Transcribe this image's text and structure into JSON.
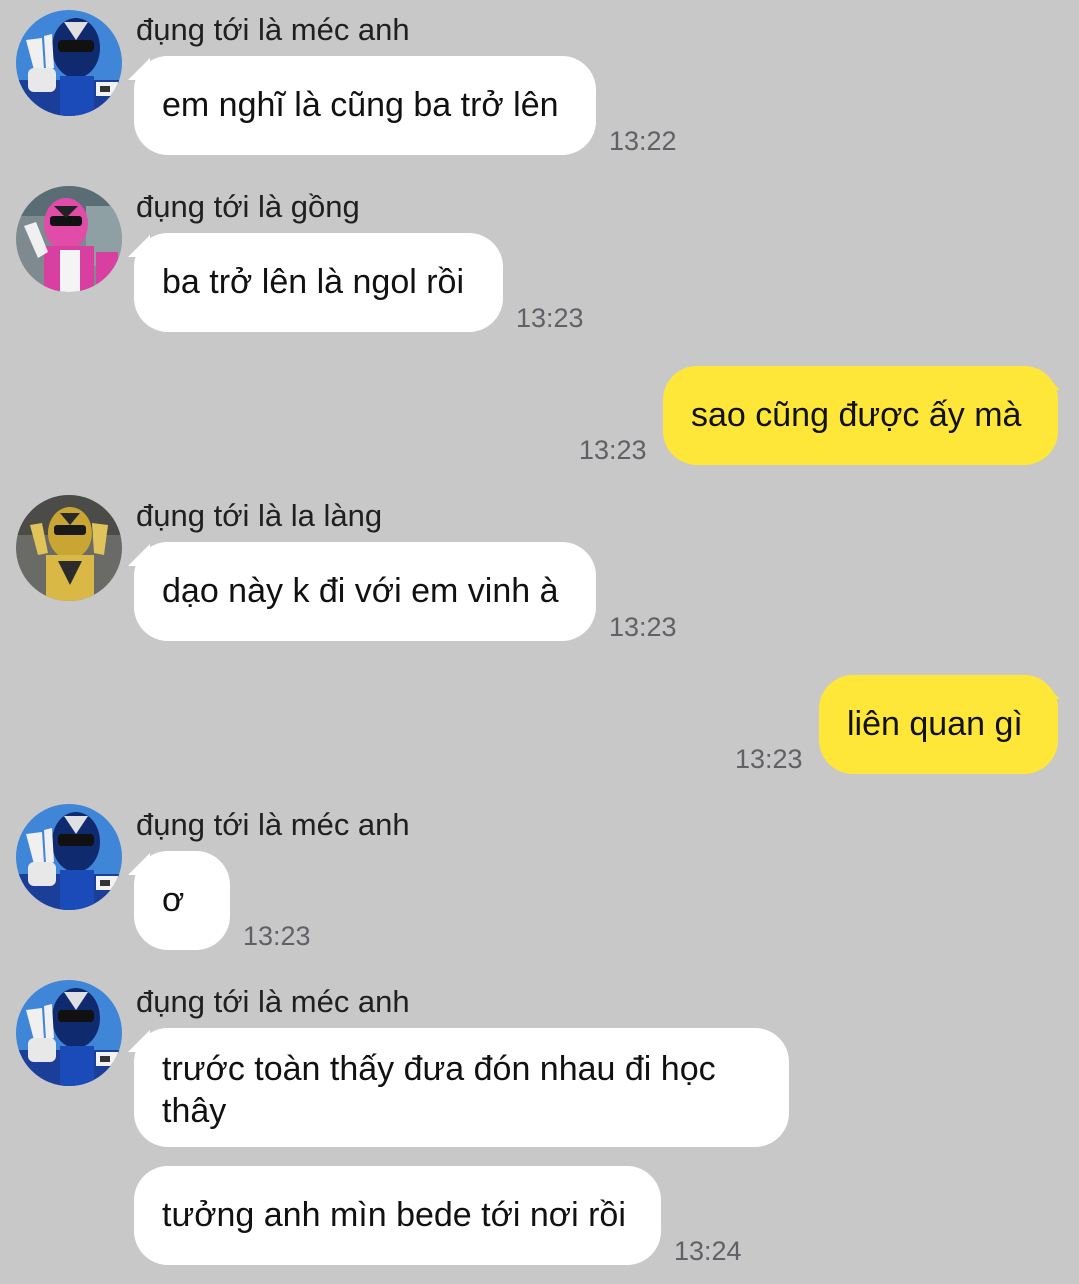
{
  "messages": [
    {
      "sender": "đụng tới là méc anh",
      "text": "em nghĩ là cũng ba trở lên",
      "time": "13:22"
    },
    {
      "sender": "đụng tới là gồng",
      "text": "ba trở lên là ngol rồi",
      "time": "13:23"
    },
    {
      "text": "sao cũng được ấy mà",
      "time": "13:23"
    },
    {
      "sender": "đụng tới là la làng",
      "text": "dạo này k đi với em vinh à",
      "time": "13:23"
    },
    {
      "text": "liên quan gì",
      "time": "13:23"
    },
    {
      "sender": "đụng tới là méc anh",
      "text": "ơ",
      "time": "13:23"
    },
    {
      "sender": "đụng tới là méc anh",
      "text": "trước toàn thấy đưa đón nhau đi học\nthây"
    },
    {
      "text": "tưởng anh mìn bede tới nơi rồi",
      "time": "13:24"
    }
  ],
  "colors": {
    "background": "#c8c8c8",
    "incoming_bubble": "#ffffff",
    "outgoing_bubble": "#ffe739",
    "timestamp": "#5f6166"
  },
  "avatars": {
    "blue": "blue-ranger-avatar",
    "pink": "pink-ranger-avatar",
    "yellow": "yellow-ranger-avatar"
  }
}
